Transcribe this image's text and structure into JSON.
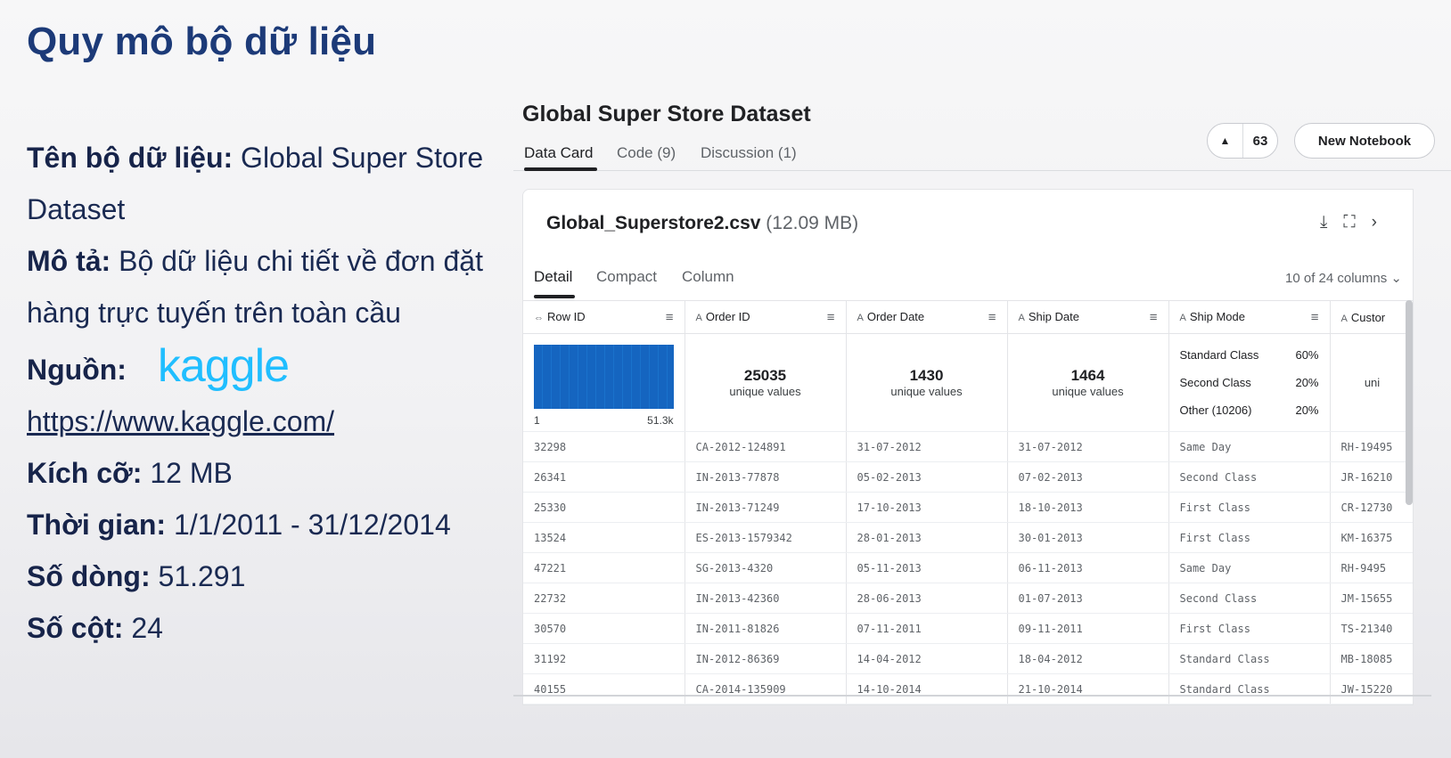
{
  "slide": {
    "title": "Quy mô bộ dữ liệu",
    "info": {
      "name_label": "Tên bộ dữ liệu:",
      "name_value": "Global Super Store Dataset",
      "desc_label": "Mô tả:",
      "desc_value": "Bộ dữ liệu chi tiết về đơn đặt hàng trực tuyến trên toàn cầu",
      "source_label": "Nguồn:",
      "source_logo": "kaggle",
      "source_url": "https://www.kaggle.com/",
      "size_label": "Kích cỡ:",
      "size_value": "12 MB",
      "time_label": "Thời gian:",
      "time_value": "1/1/2011 - 31/12/2014",
      "rows_label": "Số dòng:",
      "rows_value": "51.291",
      "cols_label": "Số cột:",
      "cols_value": "24"
    }
  },
  "kaggle": {
    "dataset_title": "Global Super Store Dataset",
    "tabs": [
      "Data Card",
      "Code (9)",
      "Discussion (1)"
    ],
    "active_tab": "Data Card",
    "upvote_icon": "caret-up-icon",
    "upvote_glyph": "▲",
    "upvote_count": "63",
    "new_notebook_label": "New Notebook",
    "file": {
      "name": "Global_Superstore2.csv",
      "size": "(12.09 MB)",
      "icons": [
        "download-icon",
        "fullscreen-icon",
        "chevron-right-icon"
      ],
      "icon_glyphs": [
        "⤓",
        "⛶",
        "›"
      ]
    },
    "subtabs": [
      "Detail",
      "Compact",
      "Column"
    ],
    "active_subtab": "Detail",
    "column_count": "10 of 24 columns",
    "column_count_chevron": "⌄",
    "columns": [
      {
        "name": "Row ID",
        "type_icon": "⇔"
      },
      {
        "name": "Order ID",
        "type_icon": "A"
      },
      {
        "name": "Order Date",
        "type_icon": "A"
      },
      {
        "name": "Ship Date",
        "type_icon": "A"
      },
      {
        "name": "Ship Mode",
        "type_icon": "A"
      },
      {
        "name": "Custor",
        "type_icon": "A"
      }
    ],
    "sort_glyph": "≡",
    "summary": {
      "row_id_hist": {
        "min": "1",
        "max": "51.3k"
      },
      "order_id": {
        "count": "25035",
        "label": "unique values"
      },
      "order_date": {
        "count": "1430",
        "label": "unique values"
      },
      "ship_date": {
        "count": "1464",
        "label": "unique values"
      },
      "ship_mode": [
        {
          "label": "Standard Class",
          "pct": "60%"
        },
        {
          "label": "Second Class",
          "pct": "20%"
        },
        {
          "label": "Other (10206)",
          "pct": "20%"
        }
      ],
      "customer_partial": "uni"
    },
    "rows": [
      [
        "32298",
        "CA-2012-124891",
        "31-07-2012",
        "31-07-2012",
        "Same Day",
        "RH-19495"
      ],
      [
        "26341",
        "IN-2013-77878",
        "05-02-2013",
        "07-02-2013",
        "Second Class",
        "JR-16210"
      ],
      [
        "25330",
        "IN-2013-71249",
        "17-10-2013",
        "18-10-2013",
        "First Class",
        "CR-12730"
      ],
      [
        "13524",
        "ES-2013-1579342",
        "28-01-2013",
        "30-01-2013",
        "First Class",
        "KM-16375"
      ],
      [
        "47221",
        "SG-2013-4320",
        "05-11-2013",
        "06-11-2013",
        "Same Day",
        "RH-9495"
      ],
      [
        "22732",
        "IN-2013-42360",
        "28-06-2013",
        "01-07-2013",
        "Second Class",
        "JM-15655"
      ],
      [
        "30570",
        "IN-2011-81826",
        "07-11-2011",
        "09-11-2011",
        "First Class",
        "TS-21340"
      ],
      [
        "31192",
        "IN-2012-86369",
        "14-04-2012",
        "18-04-2012",
        "Standard Class",
        "MB-18085"
      ],
      [
        "40155",
        "CA-2014-135909",
        "14-10-2014",
        "21-10-2014",
        "Standard Class",
        "JW-15220"
      ]
    ]
  }
}
